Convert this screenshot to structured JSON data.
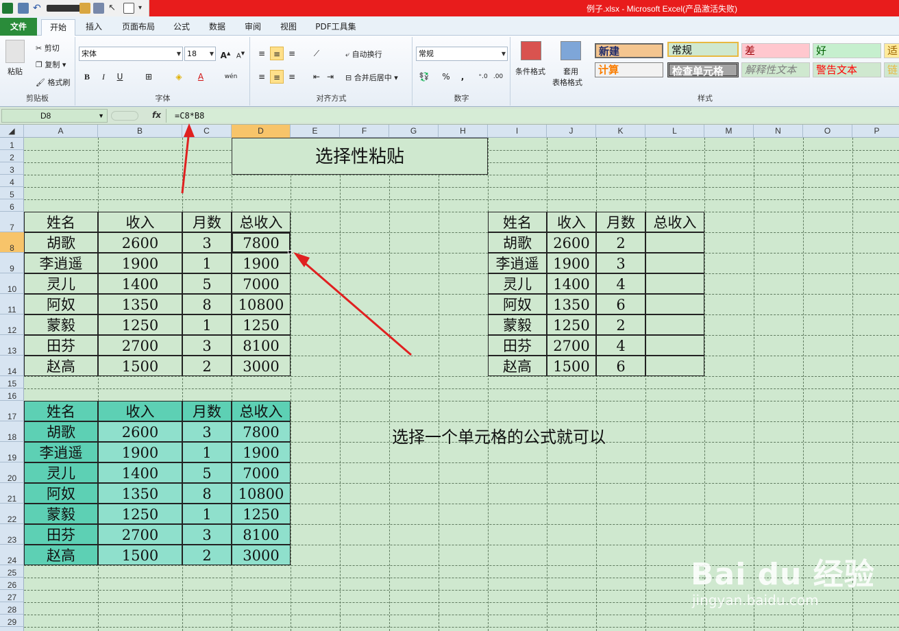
{
  "window": {
    "title": "例子.xlsx - Microsoft Excel(产品激活失败)"
  },
  "tabs": [
    "文件",
    "开始",
    "插入",
    "页面布局",
    "公式",
    "数据",
    "审阅",
    "视图",
    "PDF工具集"
  ],
  "ribbon": {
    "clipboard": {
      "paste": "粘贴",
      "cut": "剪切",
      "copy": "复制",
      "format_painter": "格式刷",
      "label": "剪贴板"
    },
    "font": {
      "name": "宋体",
      "size": "18",
      "label": "字体"
    },
    "alignment": {
      "wrap": "自动换行",
      "merge": "合并后居中",
      "label": "对齐方式"
    },
    "number": {
      "format": "常规",
      "label": "数字"
    },
    "styles": {
      "cond_format": "条件格式",
      "table_format_1": "套用",
      "table_format_2": "表格格式",
      "cells": [
        "新建",
        "常规",
        "差",
        "好",
        "适",
        "计算",
        "检查单元格",
        "解释性文本",
        "警告文本",
        "链"
      ],
      "label": "样式"
    }
  },
  "formula_bar": {
    "name_box": "D8",
    "fx": "fx",
    "formula": "=C8*B8"
  },
  "columns": [
    "A",
    "B",
    "C",
    "D",
    "E",
    "F",
    "G",
    "H",
    "I",
    "J",
    "K",
    "L",
    "M",
    "N",
    "O",
    "P"
  ],
  "rows": [
    "1",
    "2",
    "3",
    "4",
    "5",
    "6",
    "7",
    "8",
    "9",
    "10",
    "11",
    "12",
    "13",
    "14",
    "15",
    "16",
    "17",
    "18",
    "19",
    "20",
    "21",
    "22",
    "23",
    "24",
    "25",
    "26",
    "27",
    "28",
    "29"
  ],
  "banner": "选择性粘贴",
  "note": "选择一个单元格的公式就可以",
  "table1": {
    "headers": [
      "姓名",
      "收入",
      "月数",
      "总收入"
    ],
    "rows": [
      [
        "胡歌",
        "2600",
        "3",
        "7800"
      ],
      [
        "李逍遥",
        "1900",
        "1",
        "1900"
      ],
      [
        "灵儿",
        "1400",
        "5",
        "7000"
      ],
      [
        "阿奴",
        "1350",
        "8",
        "10800"
      ],
      [
        "蒙毅",
        "1250",
        "1",
        "1250"
      ],
      [
        "田芬",
        "2700",
        "3",
        "8100"
      ],
      [
        "赵高",
        "1500",
        "2",
        "3000"
      ]
    ]
  },
  "table2": {
    "headers": [
      "姓名",
      "收入",
      "月数",
      "总收入"
    ],
    "rows": [
      [
        "胡歌",
        "2600",
        "2",
        ""
      ],
      [
        "李逍遥",
        "1900",
        "3",
        ""
      ],
      [
        "灵儿",
        "1400",
        "4",
        ""
      ],
      [
        "阿奴",
        "1350",
        "6",
        ""
      ],
      [
        "蒙毅",
        "1250",
        "2",
        ""
      ],
      [
        "田芬",
        "2700",
        "4",
        ""
      ],
      [
        "赵高",
        "1500",
        "6",
        ""
      ]
    ]
  },
  "table3": {
    "headers": [
      "姓名",
      "收入",
      "月数",
      "总收入"
    ],
    "rows": [
      [
        "胡歌",
        "2600",
        "3",
        "7800"
      ],
      [
        "李逍遥",
        "1900",
        "1",
        "1900"
      ],
      [
        "灵儿",
        "1400",
        "5",
        "7000"
      ],
      [
        "阿奴",
        "1350",
        "8",
        "10800"
      ],
      [
        "蒙毅",
        "1250",
        "1",
        "1250"
      ],
      [
        "田芬",
        "2700",
        "3",
        "8100"
      ],
      [
        "赵高",
        "1500",
        "2",
        "3000"
      ]
    ]
  },
  "watermark": {
    "logo": "Bai du 经验",
    "url": "jingyan.baidu.com"
  },
  "colors": {
    "accent": "#2a8c3a",
    "title_bar": "#e81c1c",
    "sheet_bg": "#cfe8cf",
    "teal_header": "#5dd0b4",
    "teal_body": "#8fe0cc",
    "arrow": "#e02020"
  }
}
